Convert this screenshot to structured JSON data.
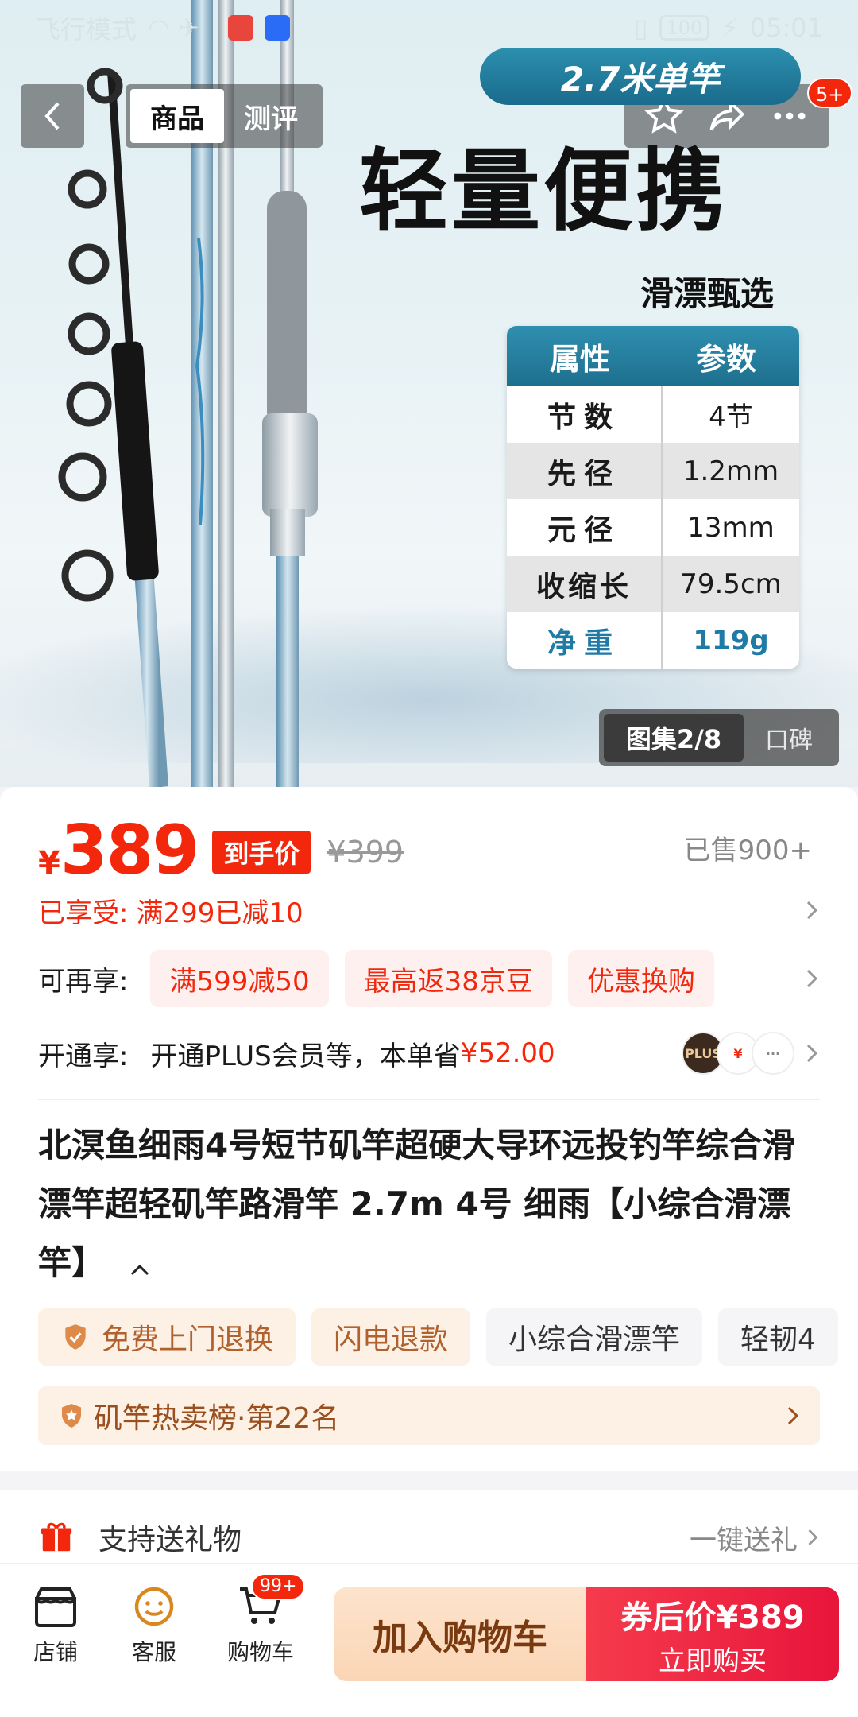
{
  "status_bar": {
    "left": "飞行模式",
    "time": "05:01",
    "battery": "100"
  },
  "nav": {
    "tabs": [
      "商品",
      "测评"
    ],
    "more_badge": "5+"
  },
  "hero": {
    "banner": "2.7米单竿",
    "headline": "轻量便携",
    "subline": "滑漂甄选",
    "spec_header": [
      "属性",
      "参数"
    ],
    "specs": [
      {
        "k": "节数",
        "v": "4节"
      },
      {
        "k": "先径",
        "v": "1.2mm"
      },
      {
        "k": "元径",
        "v": "13mm"
      },
      {
        "k": "收缩长",
        "v": "79.5cm"
      },
      {
        "k": "净重",
        "v": "119g"
      }
    ],
    "gallery": "图集2/8",
    "reviews_tab": "口碑"
  },
  "price": {
    "currency": "¥",
    "value": "389",
    "final_tag": "到手价",
    "original": "¥399",
    "sold": "已售900+"
  },
  "promos": {
    "enjoyed_label": "已享受:",
    "enjoyed_value": "满299已减10",
    "more_label": "可再享:",
    "chips": [
      "满599减50",
      "最高返38京豆",
      "优惠换购"
    ],
    "plus_label": "开通享:",
    "plus_text": "开通PLUS会员等，本单省",
    "plus_save": "¥52.00"
  },
  "product": {
    "title": "北溟鱼细雨4号短节矶竿超硬大导环远投钓竿综合滑漂竿超轻矶竿路滑竿 2.7m 4号 细雨【小综合滑漂竿】",
    "tags": [
      "免费上门退换",
      "闪电退款",
      "小综合滑漂竿",
      "轻韧4"
    ],
    "rank": "矶竿热卖榜·第22名"
  },
  "gift": {
    "label": "支持送礼物",
    "action": "一键送礼"
  },
  "bottom_bar": {
    "store": "店铺",
    "service": "客服",
    "cart": "购物车",
    "cart_badge": "99+",
    "add_cart": "加入购物车",
    "buy_price": "券后价¥389",
    "buy_label": "立即购买"
  },
  "colors": {
    "accent": "#f2270c",
    "spec_blue": "#1f7aa6",
    "cart_btn": "#fbd5b5",
    "buy_btn": "#e8153b"
  }
}
